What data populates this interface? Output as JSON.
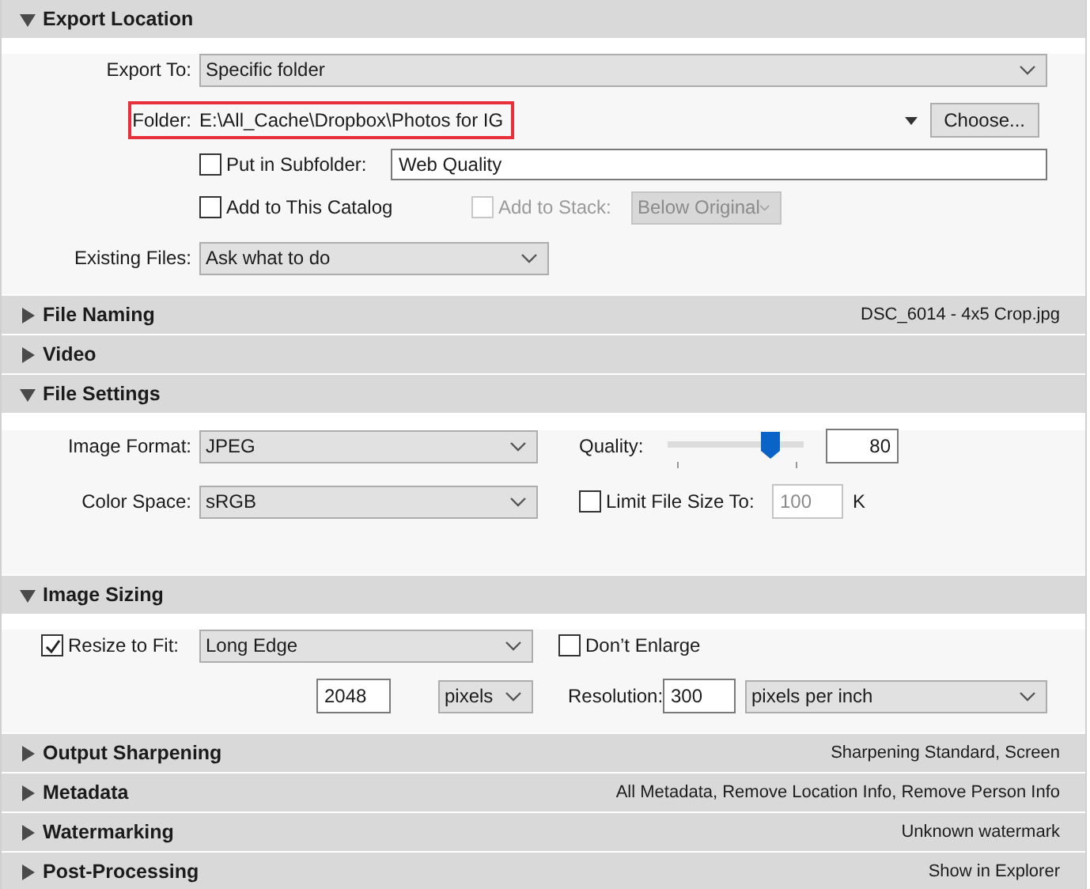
{
  "sections": [
    {
      "title": "Export Location",
      "expanded": true,
      "kind": "export_location",
      "export_to": {
        "label": "Export To:",
        "value": "Specific folder"
      },
      "folder": {
        "label": "Folder:",
        "path": "E:\\All_Cache\\Dropbox\\Photos for IG",
        "highlighted": true,
        "button": "Choose..."
      },
      "subfolder": {
        "label": "Put in Subfolder:",
        "checked": false,
        "value": "Web Quality"
      },
      "catalog": {
        "label": "Add to This Catalog",
        "checked": false
      },
      "stack": {
        "label": "Add to Stack:",
        "checked": false,
        "disabled": true,
        "value": "Below Original"
      },
      "existing_files": {
        "label": "Existing Files:",
        "value": "Ask what to do"
      }
    },
    {
      "title": "File Naming",
      "expanded": false,
      "summary": "DSC_6014 - 4x5 Crop.jpg"
    },
    {
      "title": "Video",
      "expanded": false
    },
    {
      "title": "File Settings",
      "expanded": true,
      "kind": "file_settings",
      "image_format": {
        "label": "Image Format:",
        "value": "JPEG"
      },
      "quality": {
        "label": "Quality:",
        "level": 0.8,
        "value": "80"
      },
      "color_space": {
        "label": "Color Space:",
        "value": "sRGB"
      },
      "limit_size": {
        "label": "Limit File Size To:",
        "checked": false,
        "value": "100",
        "disabled": true,
        "unit": "K"
      }
    },
    {
      "title": "Image Sizing",
      "expanded": true,
      "kind": "image_sizing",
      "resize": {
        "label": "Resize to Fit:",
        "checked": true,
        "value": "Long Edge"
      },
      "dont_enlarge": {
        "label": "Don’t Enlarge",
        "checked": false
      },
      "size": {
        "value": "2048",
        "unit": "pixels"
      },
      "resolution": {
        "label": "Resolution:",
        "value": "300",
        "unit": "pixels per inch"
      }
    },
    {
      "title": "Output Sharpening",
      "expanded": false,
      "summary": "Sharpening Standard, Screen"
    },
    {
      "title": "Metadata",
      "expanded": false,
      "summary": "All Metadata, Remove Location Info, Remove Person Info"
    },
    {
      "title": "Watermarking",
      "expanded": false,
      "summary": "Unknown watermark"
    },
    {
      "title": "Post-Processing",
      "expanded": false,
      "summary": "Show in Explorer"
    }
  ]
}
